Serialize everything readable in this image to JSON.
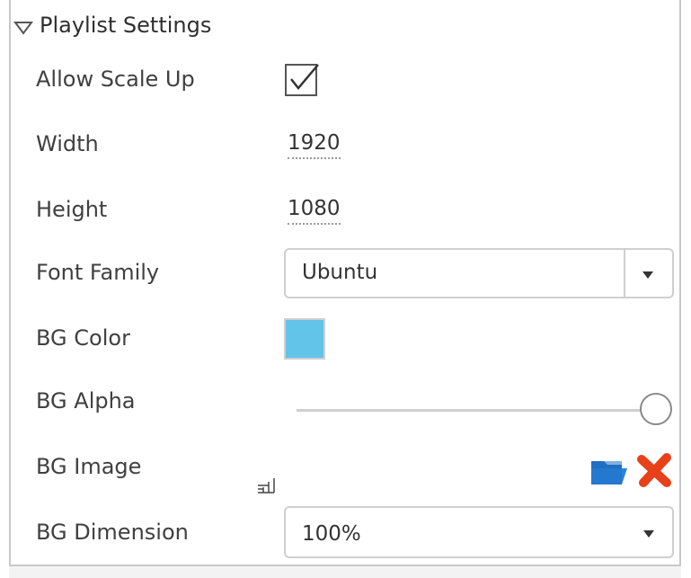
{
  "section": {
    "title": "Playlist Settings"
  },
  "fields": {
    "allow_scale_up": {
      "label": "Allow Scale Up",
      "checked": true
    },
    "width": {
      "label": "Width",
      "value": "1920"
    },
    "height": {
      "label": "Height",
      "value": "1080"
    },
    "font_family": {
      "label": "Font Family",
      "value": "Ubuntu"
    },
    "bg_color": {
      "label": "BG Color",
      "color": "#62c4e8"
    },
    "bg_alpha": {
      "label": "BG Alpha",
      "level_percent": 100
    },
    "bg_image": {
      "label": "BG Image"
    },
    "bg_dimension": {
      "label": "BG Dimension",
      "value": "100%"
    }
  },
  "icons": {
    "section_toggle": "triangle-down-icon",
    "folder": "folder-icon",
    "remove": "close-x-icon",
    "resize": "resize-handle-icon"
  },
  "colors": {
    "accent_blue": "#1f6fc2",
    "remove_red": "#e8411a",
    "swatch": "#62c4e8"
  }
}
